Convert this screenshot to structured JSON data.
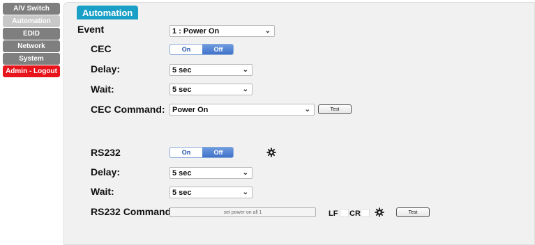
{
  "sidebar": {
    "items": [
      {
        "label": "A/V Switch"
      },
      {
        "label": "Automation"
      },
      {
        "label": "EDID"
      },
      {
        "label": "Network"
      },
      {
        "label": "System"
      },
      {
        "label": "Admin - Logout"
      }
    ]
  },
  "panel": {
    "title": "Automation"
  },
  "event": {
    "label": "Event",
    "value": "1 : Power On"
  },
  "cec": {
    "label": "CEC",
    "on_label": "On",
    "off_label": "Off",
    "selected": "Off",
    "delay_label": "Delay:",
    "delay_value": "5 sec",
    "wait_label": "Wait:",
    "wait_value": "5 sec",
    "command_label": "CEC Command:",
    "command_value": "Power On",
    "test_label": "Test"
  },
  "rs232": {
    "label": "RS232",
    "on_label": "On",
    "off_label": "Off",
    "selected": "Off",
    "delay_label": "Delay:",
    "delay_value": "5 sec",
    "wait_label": "Wait:",
    "wait_value": "5 sec",
    "command_label": "RS232 Command:",
    "command_value": "set power on all 1",
    "lf_label": "LF",
    "cr_label": "CR",
    "test_label": "Test"
  },
  "icons": {
    "settings": "gear-icon",
    "dropdown": "chevron-down-icon"
  },
  "colors": {
    "accent": "#1a9fc6",
    "logout": "#e8141b",
    "toggle_active": "#3f72c9"
  }
}
